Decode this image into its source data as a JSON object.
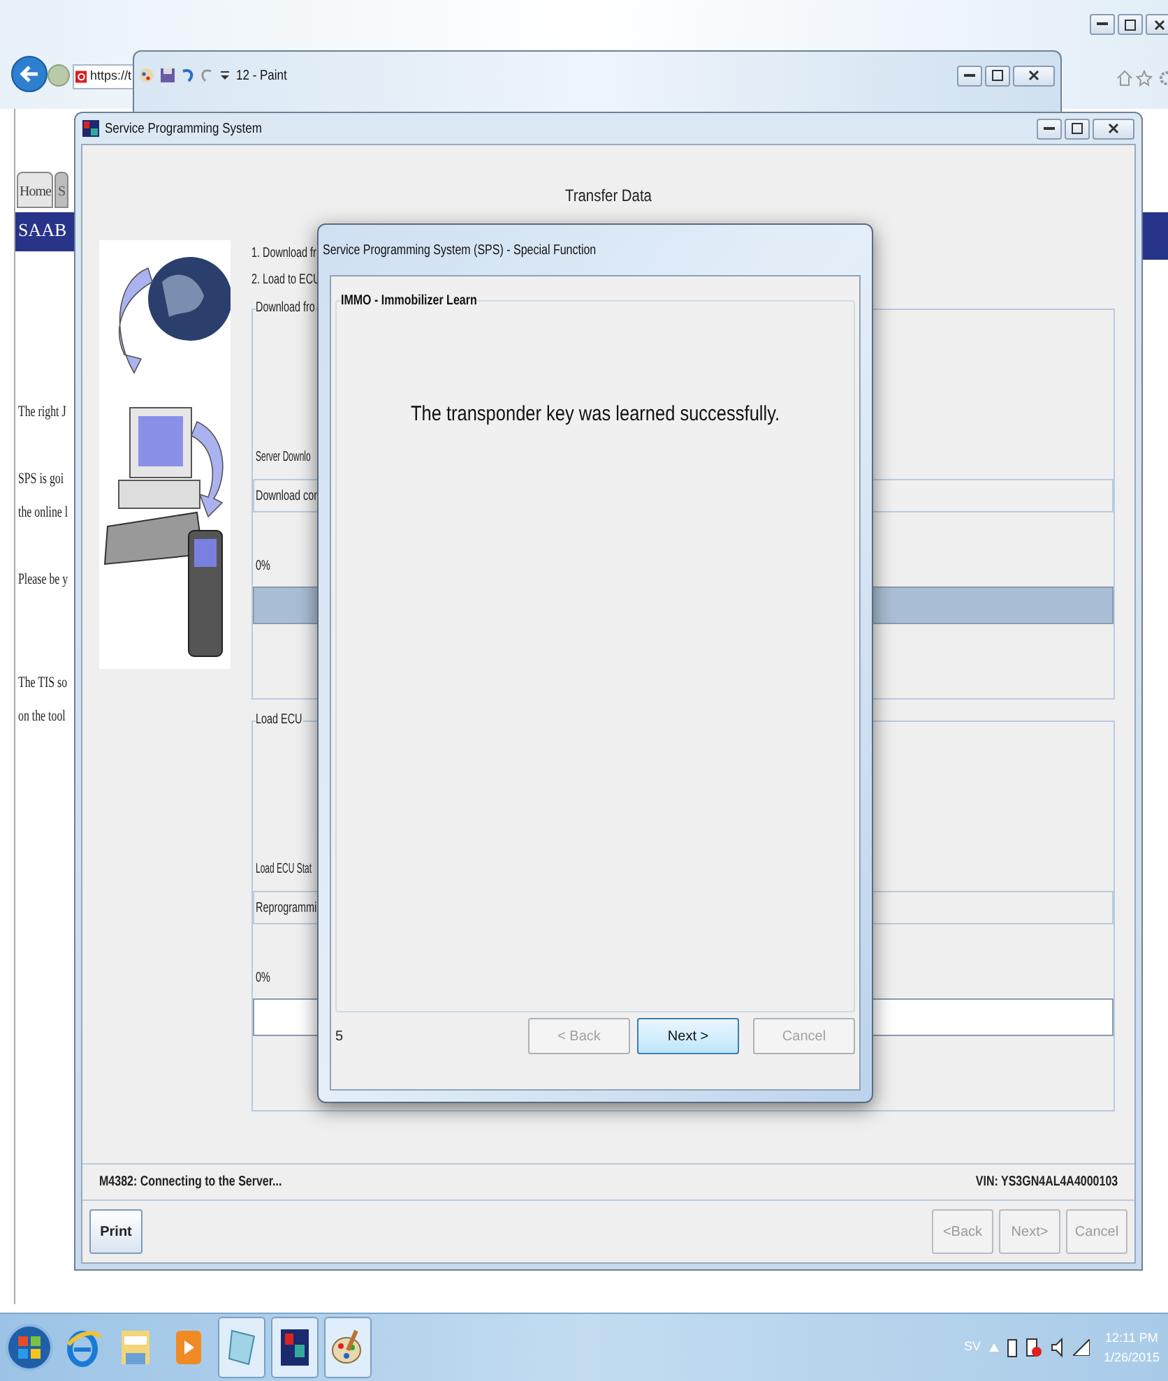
{
  "browser": {
    "address": "https://t",
    "tabs": [
      {
        "label": "Home",
        "selected": true
      },
      {
        "label": "S",
        "selected": false
      }
    ],
    "brand_bar": "SAAB",
    "paragraphs": [
      [
        "The right J"
      ],
      [
        "SPS is goi",
        "the online l"
      ],
      [
        "Please be y"
      ],
      [
        "The TIS so",
        "on the tool"
      ]
    ]
  },
  "paint_window": {
    "title": "12 - Paint"
  },
  "sps_window": {
    "title": "Service Programming System",
    "heading": "Transfer Data",
    "steps": [
      "1. Download fr",
      "2. Load to ECU"
    ],
    "groups": [
      {
        "title": "Download fro",
        "status_label": "Server Downlo",
        "status_value": "Download con",
        "percent": "0%",
        "level": 1
      },
      {
        "title": "Load ECU",
        "status_label": "Load ECU Stat",
        "status_value": "Reprogrammi",
        "percent": "0%",
        "level": 0
      }
    ],
    "status_message": "M4382: Connecting to the Server...",
    "vin": "VIN: YS3GN4AL4A4000103",
    "buttons": [
      {
        "label": "Print",
        "disabled": false
      },
      {
        "label": "<Back",
        "disabled": true
      },
      {
        "label": "Next>",
        "disabled": true
      },
      {
        "label": "Cancel",
        "disabled": true
      }
    ]
  },
  "dialog": {
    "title": "Service Programming System (SPS) - Special Function",
    "group_title": "IMMO - Immobilizer Learn",
    "message": "The transponder key was learned successfully.",
    "step": "5",
    "buttons": [
      {
        "label": "< Back",
        "disabled": true,
        "default": false
      },
      {
        "label": "Next >",
        "disabled": false,
        "default": true
      },
      {
        "label": "Cancel",
        "disabled": true,
        "default": false
      }
    ]
  },
  "taskbar": {
    "apps": [
      {
        "kind": "browser",
        "active": false
      },
      {
        "kind": "folder",
        "active": false
      },
      {
        "kind": "media",
        "active": false
      },
      {
        "kind": "notepad",
        "active": true
      },
      {
        "kind": "sps",
        "active": true
      },
      {
        "kind": "paint",
        "active": true
      }
    ],
    "language": "SV",
    "time": "12:11 PM",
    "date": "1/26/2015"
  }
}
